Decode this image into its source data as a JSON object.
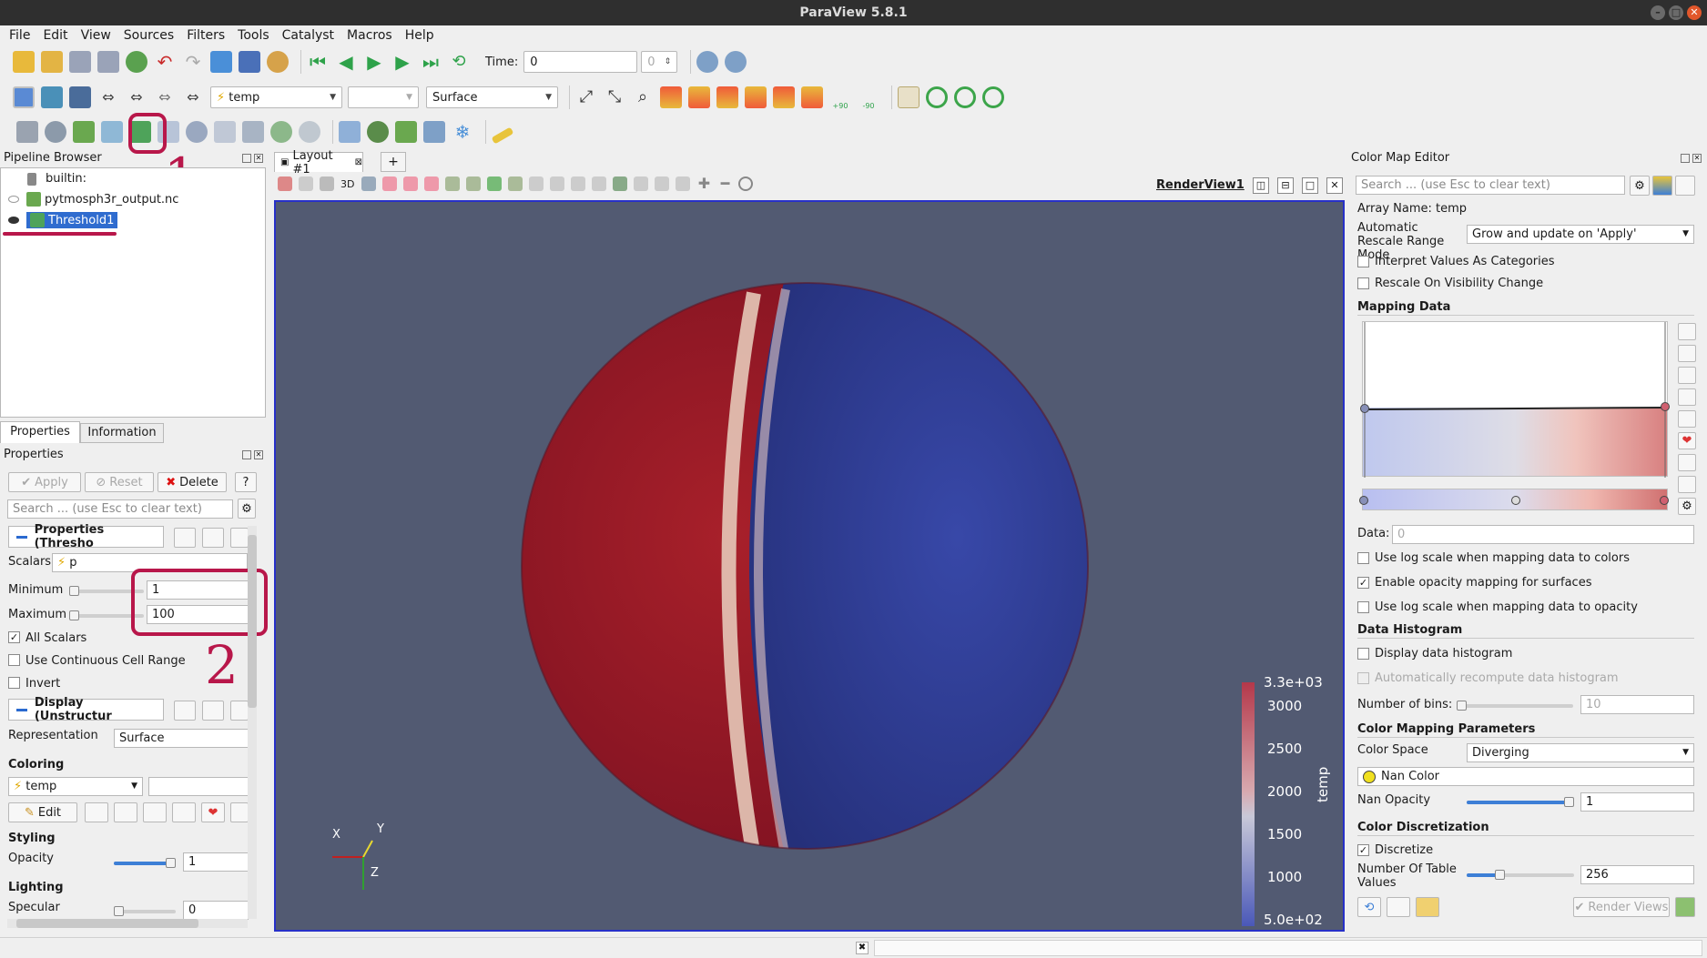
{
  "window": {
    "title": "ParaView 5.8.1"
  },
  "menu": [
    "File",
    "Edit",
    "View",
    "Sources",
    "Filters",
    "Tools",
    "Catalyst",
    "Macros",
    "Help"
  ],
  "toolbar": {
    "time_label": "Time:",
    "time_value": "0",
    "time_index": "0",
    "array_combo": "temp",
    "representation_combo": "Surface",
    "rotate_plus": "+90",
    "rotate_minus": "-90"
  },
  "pipeline": {
    "title": "Pipeline Browser",
    "items": [
      "builtin:",
      "pytmosph3r_output.nc",
      "Threshold1"
    ]
  },
  "props": {
    "tabs": [
      "Properties",
      "Information"
    ],
    "title": "Properties",
    "apply": "Apply",
    "reset": "Reset",
    "delete": "Delete",
    "help": "?",
    "search_placeholder": "Search ... (use Esc to clear text)",
    "section1": "Properties (Thresho",
    "scalars_label": "Scalars",
    "scalars_value": "p",
    "min_label": "Minimum",
    "min_value": "1",
    "max_label": "Maximum",
    "max_value": "100",
    "all_scalars": "All Scalars",
    "cont_cell": "Use Continuous Cell Range",
    "invert": "Invert",
    "section2": "Display (Unstructur",
    "repr_label": "Representation",
    "repr_value": "Surface",
    "coloring": "Coloring",
    "coloring_value": "temp",
    "edit": "Edit",
    "styling": "Styling",
    "opacity_label": "Opacity",
    "opacity_value": "1",
    "lighting": "Lighting",
    "specular_label": "Specular",
    "specular_value": "0"
  },
  "layout": {
    "tab": "Layout #1",
    "add": "+",
    "render_view": "RenderView1",
    "mode_3d": "3D"
  },
  "scalarbar": {
    "title": "temp",
    "max_label": "3.3e+03",
    "min_label": "5.0e+02",
    "ticks": [
      "3000",
      "2500",
      "2000",
      "1500",
      "1000"
    ]
  },
  "axes": {
    "x": "X",
    "y": "Y",
    "z": "Z"
  },
  "annotations": [
    "1",
    "2"
  ],
  "colormap": {
    "title": "Color Map Editor",
    "search_placeholder": "Search ... (use Esc to clear text)",
    "array_name": "Array Name: temp",
    "auto_rescale_label": "Automatic Rescale Range Mode",
    "auto_rescale_value": "Grow and update on 'Apply'",
    "interpret": "Interpret Values As Categories",
    "rescale_vis": "Rescale On Visibility Change",
    "mapping_data": "Mapping Data",
    "data_label": "Data:",
    "data_value": "0",
    "log_colors": "Use log scale when mapping data to colors",
    "opacity_mapping": "Enable opacity mapping for surfaces",
    "log_opacity": "Use log scale when mapping data to opacity",
    "data_histogram": "Data Histogram",
    "display_hist": "Display data histogram",
    "auto_recompute": "Automatically recompute data histogram",
    "bins_label": "Number of bins:",
    "bins_value": "10",
    "cm_params": "Color Mapping Parameters",
    "color_space_label": "Color Space",
    "color_space_value": "Diverging",
    "nan_color": "Nan Color",
    "nan_opacity_label": "Nan Opacity",
    "nan_opacity_value": "1",
    "discretization": "Color Discretization",
    "discretize": "Discretize",
    "table_values_label": "Number Of Table Values",
    "table_values_value": "256",
    "render_views": "Render Views"
  },
  "status": {
    "close": "✖"
  }
}
